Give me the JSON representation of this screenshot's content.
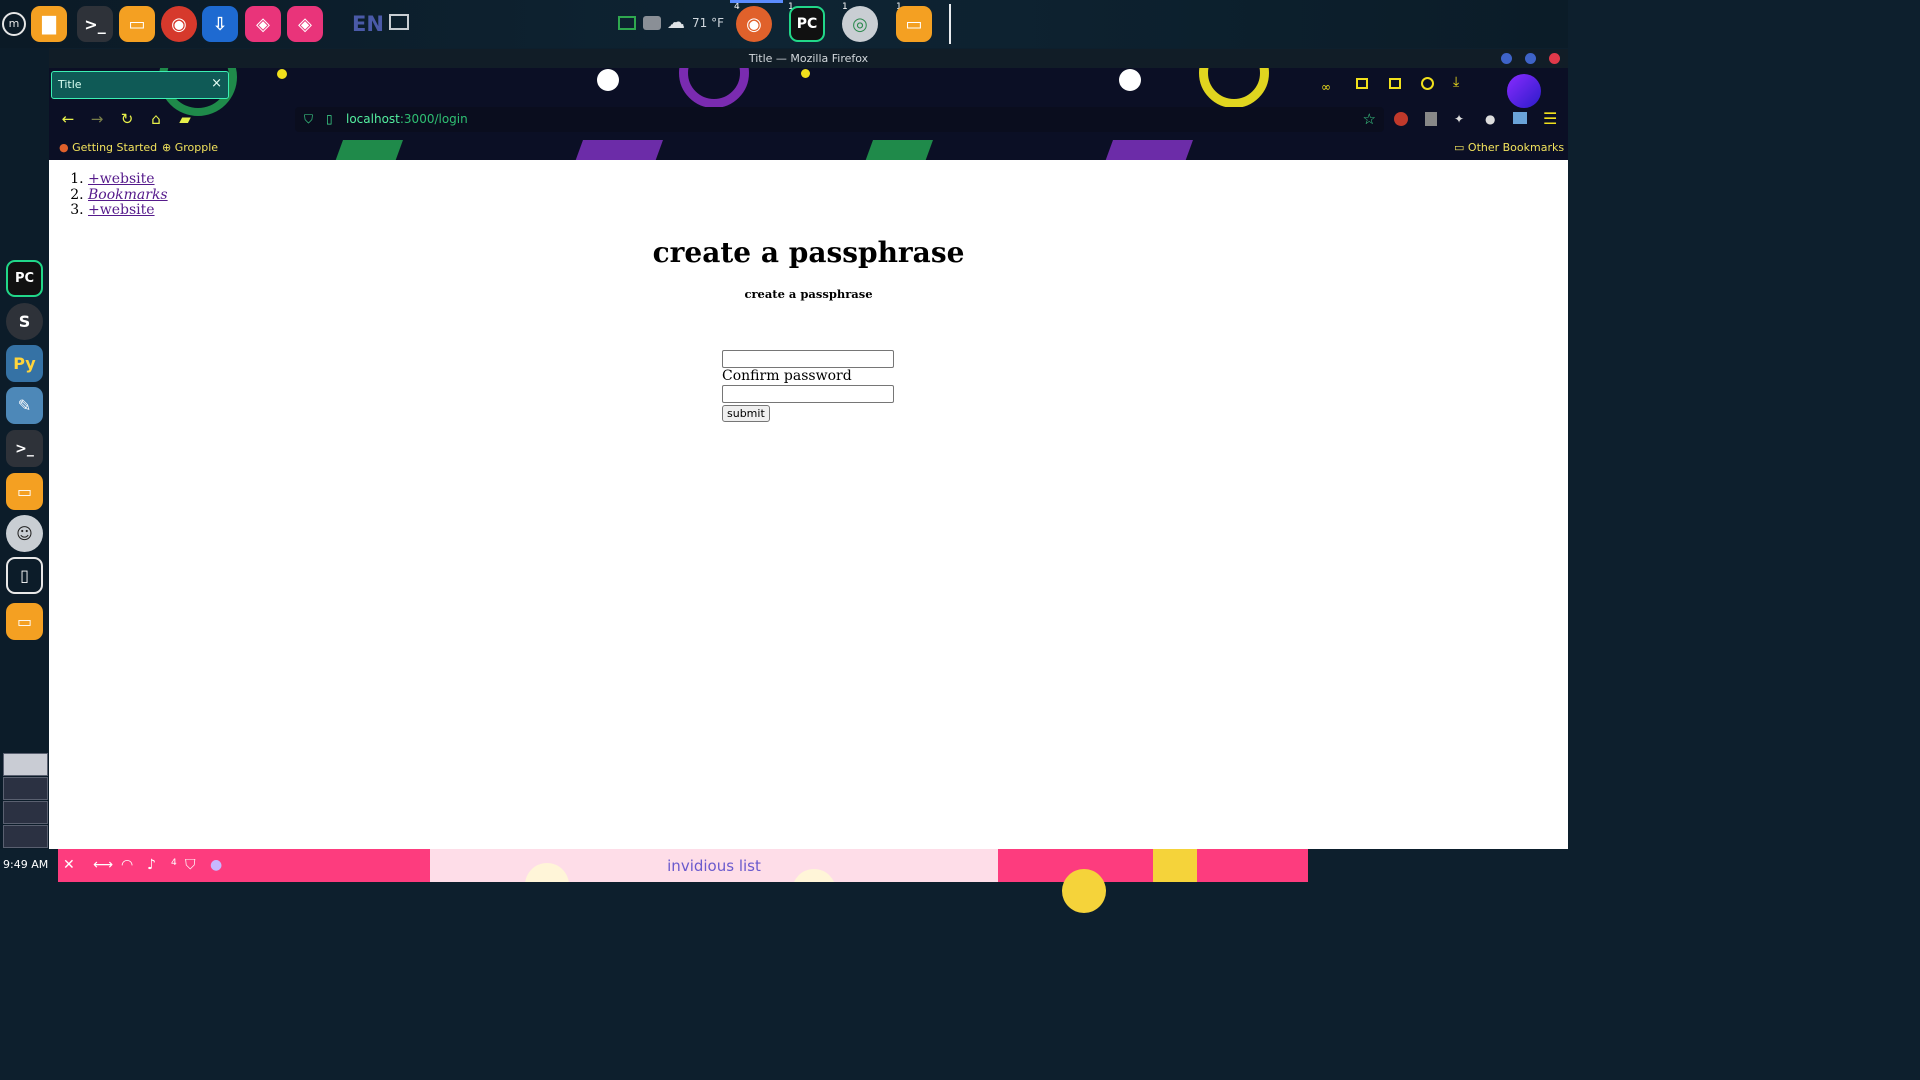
{
  "top_panel": {
    "apps": [
      {
        "name": "files-app"
      },
      {
        "name": "terminal-app"
      },
      {
        "name": "folder-app"
      },
      {
        "name": "firefox-app"
      },
      {
        "name": "installer-app"
      },
      {
        "name": "store-app-1"
      },
      {
        "name": "store-app-2"
      }
    ],
    "language": "EN",
    "weather": "71 °F",
    "running_badges": [
      "4",
      "1",
      "1",
      "1"
    ]
  },
  "browser": {
    "window_title": "Title — Mozilla Firefox",
    "tab_title": "Title",
    "tab_close": "×",
    "url_host": "localhost",
    "url_path": ":3000/login",
    "bookmarks": [
      "Getting Started",
      "Gropple"
    ],
    "other_bookmarks": "Other Bookmarks"
  },
  "page": {
    "links": [
      "+website",
      "Bookmarks",
      "+website"
    ],
    "heading": "create a passphrase",
    "subheading": "create a passphrase",
    "confirm_label": "Confirm password",
    "submit_label": "submit"
  },
  "bottom_panel": {
    "clock": "9:49 AM",
    "notification_count": "4",
    "task_label": "invidious list"
  },
  "colors": {
    "bottom_panel": "#fd3c7e",
    "url_green": "#3fdf8f",
    "chrome_yellow": "#e7f04a",
    "link_visited": "#551a8b"
  }
}
